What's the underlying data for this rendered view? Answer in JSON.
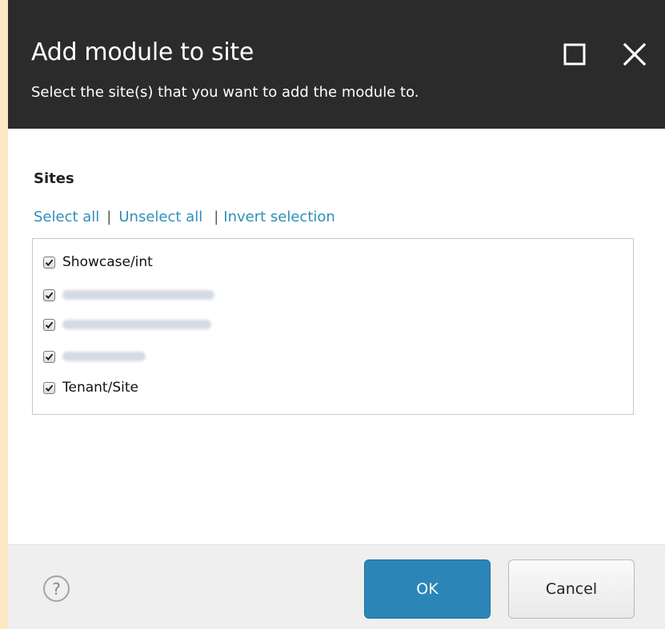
{
  "dialog": {
    "title": "Add module to site",
    "subtitle": "Select the site(s) that you want to add the module to.",
    "maximize_icon": "maximize-icon",
    "close_icon": "close-icon"
  },
  "sites": {
    "label": "Sites",
    "links": {
      "select_all": "Select all",
      "unselect_all": "Unselect all",
      "invert_selection": "Invert selection",
      "separator": "|"
    },
    "items": [
      {
        "label": "Showcase/int",
        "checked": true,
        "blurred": false
      },
      {
        "label": "",
        "checked": true,
        "blurred": true
      },
      {
        "label": "",
        "checked": true,
        "blurred": true
      },
      {
        "label": "",
        "checked": true,
        "blurred": true
      },
      {
        "label": "Tenant/Site",
        "checked": true,
        "blurred": false
      }
    ]
  },
  "footer": {
    "help_icon": "help-icon",
    "help_glyph": "?",
    "ok_label": "OK",
    "cancel_label": "Cancel"
  },
  "colors": {
    "header_bg": "#2b2b2b",
    "link": "#2f8fbb",
    "primary_button": "#2b86b7",
    "page_bg": "#fde7c4"
  }
}
